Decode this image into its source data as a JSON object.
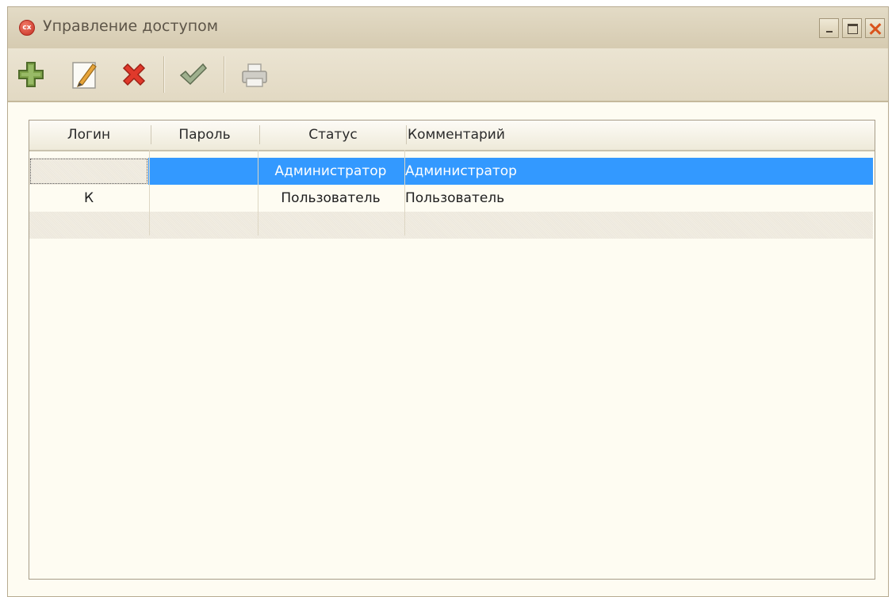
{
  "window": {
    "title": "Управление доступом",
    "icon": "app-logo-icon",
    "icon_text": "cx",
    "controls": [
      "minimize-icon",
      "maximize-icon",
      "close-icon"
    ]
  },
  "toolbar": {
    "buttons": [
      {
        "name": "add-button",
        "icon": "plus-icon"
      },
      {
        "name": "edit-button",
        "icon": "pencil-icon"
      },
      {
        "name": "delete-button",
        "icon": "x-icon"
      },
      {
        "name": "apply-button",
        "icon": "checkmark-icon"
      },
      {
        "name": "print-button",
        "icon": "printer-icon"
      }
    ]
  },
  "grid": {
    "columns": [
      "Логин",
      "Пароль",
      "Статус",
      "Комментарий"
    ],
    "rows": [
      {
        "login": "",
        "password": "",
        "status": "Администратор",
        "comment": "Администратор",
        "selected": true
      },
      {
        "login": "К",
        "password": "",
        "status": "Пользователь",
        "comment": "Пользователь",
        "selected": false
      }
    ]
  },
  "colors": {
    "selection": "#3399ff",
    "window_bg": "#fefcf2",
    "titlebar": "#ddd4bc",
    "close_accent": "#d9531c",
    "add_green": "#6a8f3a",
    "delete_red": "#e0392b"
  }
}
